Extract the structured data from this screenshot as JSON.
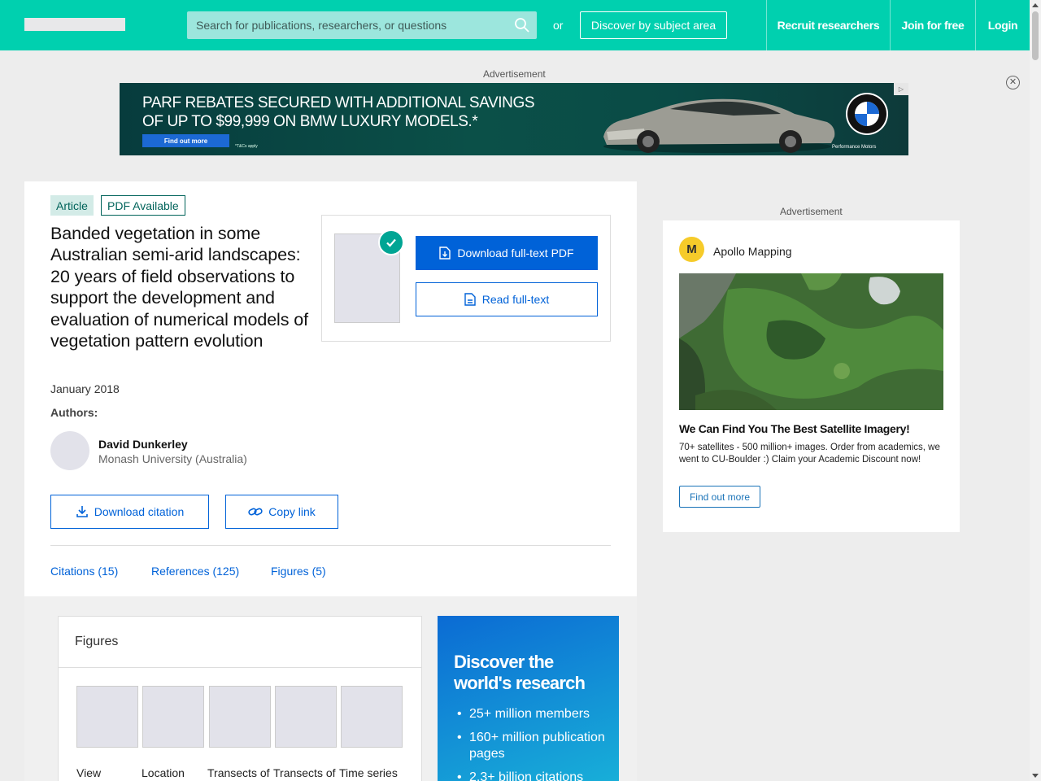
{
  "header": {
    "search_placeholder": "Search for publications, researchers, or questions",
    "or_text": "or",
    "discover_label": "Discover by subject area",
    "recruit_label": "Recruit researchers",
    "join_label": "Join for free",
    "login_label": "Login"
  },
  "ads": {
    "top_label": "Advertisement",
    "side_label": "Advertisement",
    "banner": {
      "line1": "PARF REBATES SECURED WITH ADDITIONAL SAVINGS",
      "line2": "OF UP TO $99,999 ON BMW LUXURY MODELS.*",
      "button": "Find out more",
      "terms": "*T&Cs apply",
      "dealer": "Performance Motors",
      "brand": "BMW"
    },
    "side": {
      "advertiser": "Apollo Mapping",
      "logo_text": "M",
      "headline": "We Can Find You The Best Satellite Imagery!",
      "body": "70+ satellites - 500 million+ images. Order from academics, we went to CU-Boulder :) Claim your Academic Discount now!",
      "button": "Find out more"
    }
  },
  "publication": {
    "type_tag": "Article",
    "pdf_tag": "PDF Available",
    "title": "Banded vegetation in some Australian semi-arid landscapes: 20 years of field observations to support the development and evaluation of numerical models of vegetation pattern evolution",
    "date": "January 2018",
    "authors_label": "Authors:",
    "authors": [
      {
        "name": "David Dunkerley",
        "institution": "Monash University (Australia)"
      }
    ],
    "download_pdf": "Download full-text PDF",
    "read_fulltext": "Read full-text",
    "download_citation": "Download citation",
    "copy_link": "Copy link"
  },
  "tabs": [
    {
      "label": "Citations (15)"
    },
    {
      "label": "References (125)"
    },
    {
      "label": "Figures (5)"
    }
  ],
  "figures": {
    "title": "Figures",
    "captions": [
      "View",
      "Location",
      "Transects of",
      "Transects of",
      "Time series"
    ]
  },
  "discover": {
    "title": "Discover the world's research",
    "items": [
      "25+ million members",
      "160+ million publication pages",
      "2.3+ billion citations"
    ]
  },
  "colors": {
    "brand": "#00d0af",
    "primary_blue": "#0062d8",
    "tag_green": "#00635a"
  }
}
